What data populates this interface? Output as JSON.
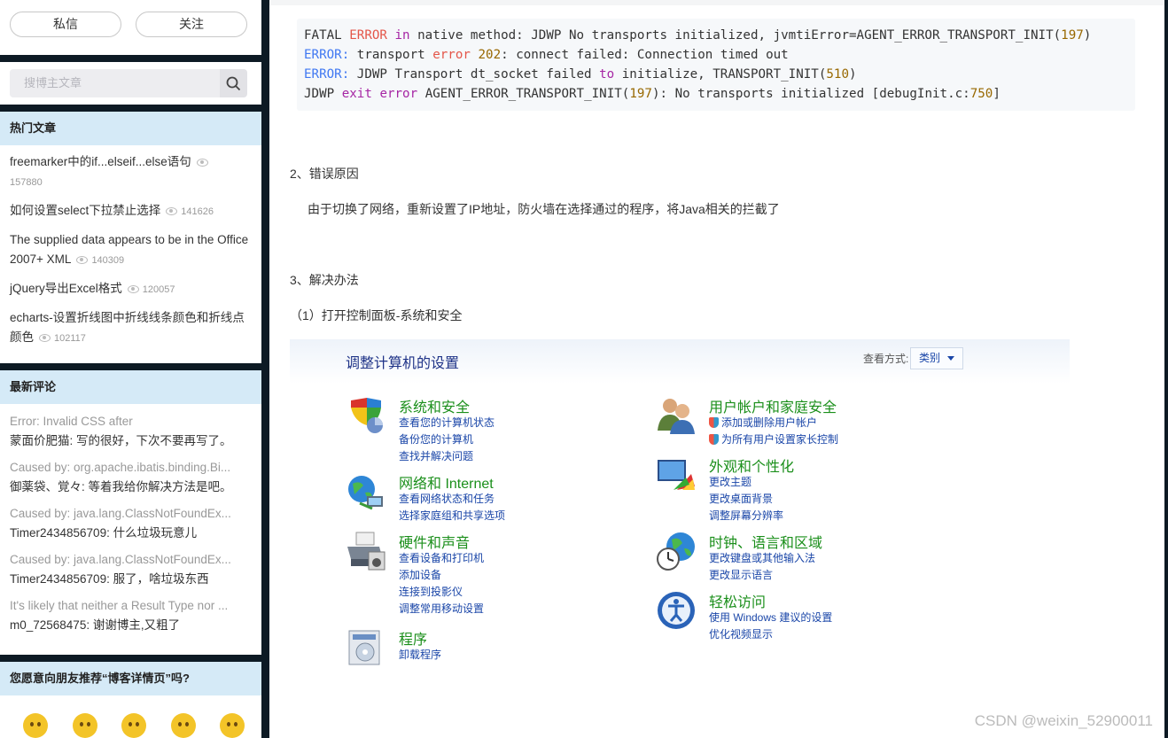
{
  "sidebar": {
    "buttons": {
      "message": "私信",
      "follow": "关注"
    },
    "search": {
      "placeholder": "搜博主文章"
    },
    "hot": {
      "title": "热门文章",
      "items": [
        {
          "title": "freemarker中的if...elseif...else语句",
          "views": "157880"
        },
        {
          "title": "如何设置select下拉禁止选择",
          "views": "141626"
        },
        {
          "title": "The supplied data appears to be in the Office 2007+ XML",
          "views": "140309"
        },
        {
          "title": "jQuery导出Excel格式",
          "views": "120057"
        },
        {
          "title": "echarts-设置折线图中折线线条颜色和折线点颜色",
          "views": "102117"
        }
      ]
    },
    "comments": {
      "title": "最新评论",
      "items": [
        {
          "quote": "Error: Invalid CSS after",
          "reply": "蒙面价肥猫: 写的很好，下次不要再写了。"
        },
        {
          "quote": "Caused by: org.apache.ibatis.binding.Bi...",
          "reply": "御薬袋、覚々: 等着我给你解决方法是吧。"
        },
        {
          "quote": "Caused by: java.lang.ClassNotFoundEx...",
          "reply": "Timer2434856709: 什么垃圾玩意儿"
        },
        {
          "quote": "Caused by: java.lang.ClassNotFoundEx...",
          "reply": "Timer2434856709: 服了，啥垃圾东西"
        },
        {
          "quote": "It's likely that neither a Result Type nor ...",
          "reply": "m0_72568475: 谢谢博主,又粗了"
        }
      ]
    },
    "recommend": {
      "title": "您愿意向朋友推荐“博客详情页”吗?"
    }
  },
  "main": {
    "code_lines": [
      "FATAL ERROR in native method: JDWP No transports initialized, jvmtiError=AGENT_ERROR_TRANSPORT_INIT(197)",
      "ERROR: transport error 202: connect failed: Connection timed out",
      "ERROR: JDWP Transport dt_socket failed to initialize, TRANSPORT_INIT(510)",
      "JDWP exit error AGENT_ERROR_TRANSPORT_INIT(197): No transports initialized [debugInit.c:750]"
    ],
    "section2_title": "2、错误原因",
    "section2_text": "由于切换了网络，重新设置了IP地址，防火墙在选择通过的程序，将Java相关的拦截了",
    "section3_title": "3、解决办法",
    "step1": "（1）打开控制面板-系统和安全",
    "control_panel": {
      "title": "调整计算机的设置",
      "view_label": "查看方式:",
      "view_value": "类别",
      "left": [
        {
          "icon": "system-security-icon",
          "title": "系统和安全",
          "links": [
            "查看您的计算机状态",
            "备份您的计算机",
            "查找并解决问题"
          ]
        },
        {
          "icon": "network-internet-icon",
          "title": "网络和 Internet",
          "links": [
            "查看网络状态和任务",
            "选择家庭组和共享选项"
          ]
        },
        {
          "icon": "hardware-sound-icon",
          "title": "硬件和声音",
          "links": [
            "查看设备和打印机",
            "添加设备",
            "连接到投影仪",
            "调整常用移动设置"
          ]
        },
        {
          "icon": "programs-icon",
          "title": "程序",
          "links": [
            "卸载程序"
          ]
        }
      ],
      "right": [
        {
          "icon": "user-accounts-icon",
          "title": "用户帐户和家庭安全",
          "links": [
            "添加或删除用户帐户",
            "为所有用户设置家长控制"
          ]
        },
        {
          "icon": "appearance-icon",
          "title": "外观和个性化",
          "links": [
            "更改主题",
            "更改桌面背景",
            "调整屏幕分辨率"
          ]
        },
        {
          "icon": "clock-language-icon",
          "title": "时钟、语言和区域",
          "links": [
            "更改键盘或其他输入法",
            "更改显示语言"
          ]
        },
        {
          "icon": "ease-of-access-icon",
          "title": "轻松访问",
          "links": [
            "使用 Windows 建议的设置",
            "优化视频显示"
          ]
        }
      ]
    },
    "watermark": "CSDN @weixin_52900011"
  }
}
